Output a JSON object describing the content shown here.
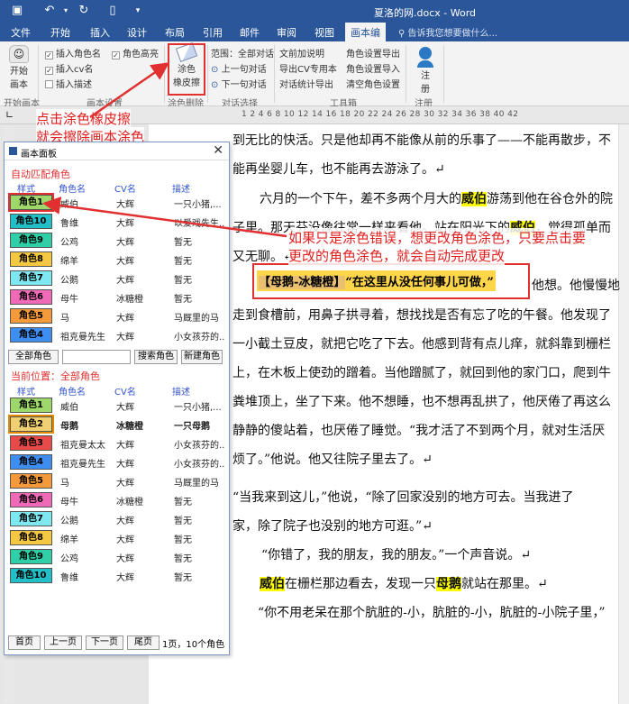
{
  "titlebar": {
    "doc_title": "夏洛的网.docx - Word"
  },
  "tabs": [
    "文件",
    "开始",
    "插入",
    "设计",
    "布局",
    "引用",
    "邮件",
    "审阅",
    "视图",
    "画本编"
  ],
  "tell_me": "告诉我您想要做什么...",
  "ribbon": {
    "start_btn": [
      "开始",
      "画本"
    ],
    "checks": [
      {
        "label": "插入角色名",
        "checked": true
      },
      {
        "label": "插入cv名",
        "checked": true
      },
      {
        "label": "插入描述",
        "checked": false
      }
    ],
    "highlight": {
      "label": "角色高亮",
      "checked": true
    },
    "eraser": [
      "涂色",
      "橡皮擦"
    ],
    "range": "范围：全部对话",
    "prev": "上一句对话",
    "next": "下一句对话",
    "tools_col1": [
      "文前加说明",
      "导出CV专用本",
      "对话统计导出"
    ],
    "tools_col2": [
      "角色设置导出",
      "角色设置导入",
      "清空角色设置"
    ],
    "logout": [
      "注",
      "册"
    ],
    "groups": [
      "开始画本",
      "画本设置",
      "涂色删除",
      "对话选择",
      "工具箱",
      "注册"
    ]
  },
  "ruler_nums": "1  2  4  6  8  10  12  14  16  18  20  22  24  26  28  30  32  34  36  38  40  42",
  "document": {
    "lines": [
      "到无比的快活。只是他却再不能像从前的乐事了——不能再散步，不",
      "能再坐婴儿车，也不能再去游泳了。↵",
      "六月的一个下午，差不多两个月大的",
      "游荡到他在谷仓外的院",
      "子里。那天芬没像往常一样来看他。站在阳光下的",
      "，觉得孤单而",
      "又无聊。↵",
      "他想。他慢慢地",
      "走到食槽前，用鼻子拱寻着，想找找是否有忘了吃的午餐。他发现了",
      "一小截土豆皮，就把它吃了下去。他感到背有点儿痒，就斜靠到栅栏",
      "上，在木板上使劲的蹭着。当他蹭腻了，就回到他的家门口，爬到牛",
      "粪堆顶上，坐了下来。他不想睡，也不想再乱拱了，他厌倦了再这么",
      "静静的傻站着，也厌倦了睡觉。“我才活了不到两个月，就对生活厌",
      "烦了。”他说。他又往院子里去了。↵",
      "“当我来到这儿，”他说，“除了回家没别的地方可去。当我进了",
      "家，除了院子也没别的地方可逛。”↵",
      "“你错了，我的朋友，我的朋友。”一个声音说。↵",
      "在栅栏那边看去，发现一只",
      "就站在那里。↵",
      "“你不用老呆在那个肮脏的-小，肮脏的-小，肮脏的-小院子里，”"
    ],
    "name_wilbur": "威伯",
    "name_goose": "母鹅",
    "dialog_tag": "【母鹅-冰糖橙】",
    "dialog_quote": "“在这里从没任何事儿可做，”"
  },
  "notes": {
    "eraser_note": [
      "点击涂色橡皮擦",
      "就会擦除画本涂色"
    ],
    "recolor_note": [
      "如果只是涂色错误，想更改角色涂色，只要点击要",
      "更改的角色涂色，就会自动完成更改"
    ]
  },
  "panel": {
    "title": "画本面板",
    "close": "✕",
    "section_auto": "自动匹配角色",
    "columns": [
      "样式",
      "角色名",
      "CV名",
      "描述"
    ],
    "auto_roles": [
      {
        "style": "角色1",
        "name": "威伯",
        "cv": "大辉",
        "desc": "一只小猪,...",
        "color": "#9fd86a"
      },
      {
        "style": "角色10",
        "name": "鲁维",
        "cv": "大辉",
        "desc": "以爱戏先生...",
        "color": "#21c0c8"
      },
      {
        "style": "角色9",
        "name": "公鸡",
        "cv": "大辉",
        "desc": "暂无",
        "color": "#2fd0a8"
      },
      {
        "style": "角色8",
        "name": "绵羊",
        "cv": "大辉",
        "desc": "暂无",
        "color": "#f5c842"
      },
      {
        "style": "角色7",
        "name": "公鹅",
        "cv": "大辉",
        "desc": "暂无",
        "color": "#7ee8f0"
      },
      {
        "style": "角色6",
        "name": "母牛",
        "cv": "冰糖橙",
        "desc": "暂无",
        "color": "#f06ab8"
      },
      {
        "style": "角色5",
        "name": "马",
        "cv": "大辉",
        "desc": "马厩里的马",
        "color": "#f59a3a"
      },
      {
        "style": "角色4",
        "name": "祖克曼先生",
        "cv": "大辉",
        "desc": "小女孩芬的...",
        "color": "#3d8ef0"
      }
    ],
    "btn_all": "全部角色",
    "search_value": "",
    "btn_search": "搜索角色",
    "btn_new": "新建角色",
    "section_current": "当前位置：全部角色",
    "current_roles": [
      {
        "style": "角色1",
        "name": "威伯",
        "cv": "大辉",
        "desc": "一只小猪,...",
        "color": "#9fd86a",
        "bold": false
      },
      {
        "style": "角色2",
        "name": "母鹅",
        "cv": "冰糖橙",
        "desc": "一只母鹅",
        "color": "#f0d070",
        "bold": true
      },
      {
        "style": "角色3",
        "name": "祖克曼太太",
        "cv": "大辉",
        "desc": "小女孩芬的...",
        "color": "#e84a4a",
        "bold": false
      },
      {
        "style": "角色4",
        "name": "祖克曼先生",
        "cv": "大辉",
        "desc": "小女孩芬的...",
        "color": "#3d8ef0",
        "bold": false
      },
      {
        "style": "角色5",
        "name": "马",
        "cv": "大辉",
        "desc": "马厩里的马",
        "color": "#f59a3a",
        "bold": false
      },
      {
        "style": "角色6",
        "name": "母牛",
        "cv": "冰糖橙",
        "desc": "暂无",
        "color": "#f06ab8",
        "bold": false
      },
      {
        "style": "角色7",
        "name": "公鹅",
        "cv": "大辉",
        "desc": "暂无",
        "color": "#7ee8f0",
        "bold": false
      },
      {
        "style": "角色8",
        "name": "绵羊",
        "cv": "大辉",
        "desc": "暂无",
        "color": "#f5c842",
        "bold": false
      },
      {
        "style": "角色9",
        "name": "公鸡",
        "cv": "大辉",
        "desc": "暂无",
        "color": "#2fd0a8",
        "bold": false
      },
      {
        "style": "角色10",
        "name": "鲁维",
        "cv": "大辉",
        "desc": "暂无",
        "color": "#21c0c8",
        "bold": false
      }
    ],
    "pager": [
      "首页",
      "上一页",
      "下一页",
      "尾页"
    ],
    "pager_info": "1页，10个角色"
  }
}
